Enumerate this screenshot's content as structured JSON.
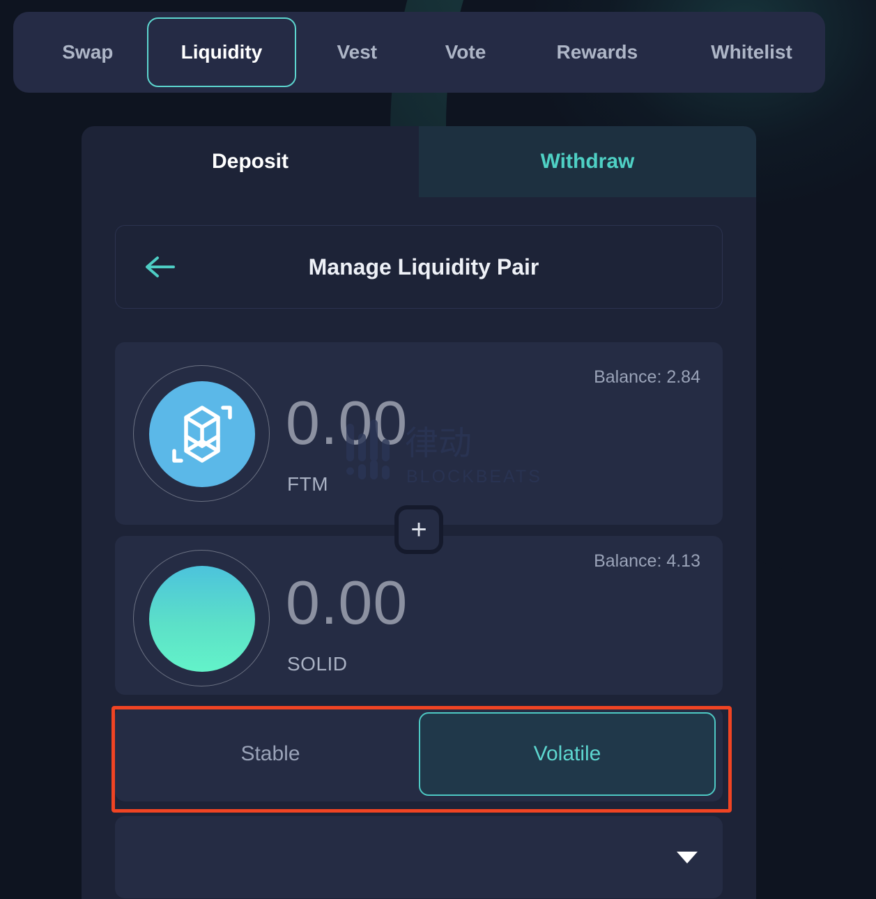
{
  "nav": {
    "tabs": [
      {
        "label": "Swap",
        "active": false
      },
      {
        "label": "Liquidity",
        "active": true
      },
      {
        "label": "Vest",
        "active": false
      },
      {
        "label": "Vote",
        "active": false
      },
      {
        "label": "Rewards",
        "active": false
      },
      {
        "label": "Whitelist",
        "active": false
      }
    ]
  },
  "mode_tabs": {
    "deposit": "Deposit",
    "withdraw": "Withdraw",
    "selected": "Withdraw"
  },
  "pair_header": {
    "title": "Manage Liquidity Pair",
    "back_icon": "arrow-left-icon"
  },
  "tokens": [
    {
      "symbol": "FTM",
      "amount": "0.00",
      "balance_label": "Balance: 2.84",
      "icon": "fantom-token-icon",
      "icon_color": "#5bb8e8"
    },
    {
      "symbol": "SOLID",
      "amount": "0.00",
      "balance_label": "Balance: 4.13",
      "icon": "solid-token-icon",
      "icon_color": "#5ce0c8"
    }
  ],
  "add_button": {
    "icon": "plus-icon",
    "label": "+"
  },
  "pool_type": {
    "stable": "Stable",
    "volatile": "Volatile",
    "selected": "Volatile"
  },
  "pair_select": {
    "value": "",
    "caret_icon": "caret-down-icon"
  },
  "watermark": {
    "cn_text": "律动",
    "en_text": "BLOCKBEATS"
  },
  "colors": {
    "accent_teal": "#5dd6cf",
    "withdraw_teal": "#4fd1c5",
    "highlight_red": "#f04423",
    "page_bg": "#0e1420",
    "panel_bg": "#1d2337",
    "card_bg": "#252c44"
  }
}
